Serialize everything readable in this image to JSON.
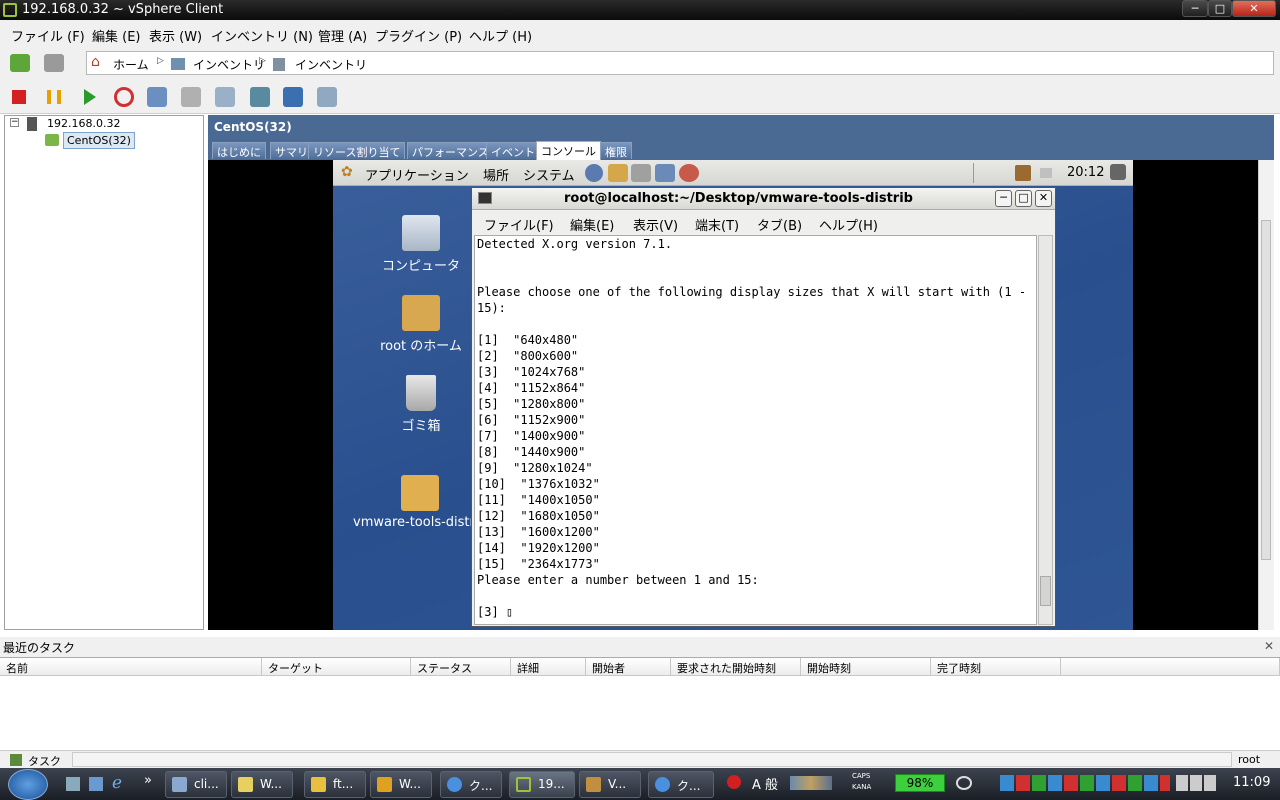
{
  "window": {
    "title": "192.168.0.32 ~ vSphere Client",
    "min": "─",
    "max": "□",
    "close": "✕"
  },
  "menu": [
    "ファイル (F)",
    "編集 (E)",
    "表示 (W)",
    "インベントリ (N)",
    "管理 (A)",
    "プラグイン (P)",
    "ヘルプ (H)"
  ],
  "nav": {
    "crumbs": [
      "ホーム",
      "インベントリ",
      "インベントリ"
    ]
  },
  "tree": {
    "host": "192.168.0.32",
    "vm": "CentOS(32)",
    "collapse": "−"
  },
  "vm": {
    "title": "CentOS(32)",
    "tabs": [
      "はじめに",
      "サマリ",
      "リソース割り当て",
      "パフォーマンス",
      "イベント",
      "コンソール",
      "権限"
    ],
    "active_tab": "コンソール"
  },
  "guest": {
    "panel": {
      "applications": "アプリケーション",
      "places": "場所",
      "system": "システム",
      "clock": "20:12"
    },
    "desktop_icons": [
      "コンピュータ",
      "root のホーム",
      "ゴミ箱",
      "vmware-tools-distr"
    ],
    "terminal": {
      "title": "root@localhost:~/Desktop/vmware-tools-distrib",
      "menu": [
        "ファイル(F)",
        "編集(E)",
        "表示(V)",
        "端末(T)",
        "タブ(B)",
        "ヘルプ(H)"
      ],
      "lines": [
        "Detected X.org version 7.1.",
        "",
        "",
        "Please choose one of the following display sizes that X will start with (1 -",
        "15):",
        "",
        "[1]  \"640x480\"",
        "[2]  \"800x600\"",
        "[3]  \"1024x768\"",
        "[4]  \"1152x864\"",
        "[5]  \"1280x800\"",
        "[6]  \"1152x900\"",
        "[7]  \"1400x900\"",
        "[8]  \"1440x900\"",
        "[9]  \"1280x1024\"",
        "[10]  \"1376x1032\"",
        "[11]  \"1400x1050\"",
        "[12]  \"1680x1050\"",
        "[13]  \"1600x1200\"",
        "[14]  \"1920x1200\"",
        "[15]  \"2364x1773\"",
        "Please enter a number between 1 and 15:",
        "",
        "[3] ▯"
      ]
    }
  },
  "tasks": {
    "header": "最近のタスク",
    "close": "✕",
    "columns": [
      "名前",
      "ターゲット",
      "ステータス",
      "詳細",
      "開始者",
      "要求された開始時刻",
      "開始時刻",
      "完了時刻"
    ]
  },
  "status": {
    "tasks_label": "タスク",
    "user": "root"
  },
  "taskbar": {
    "items": [
      "cli...",
      "W...",
      "ft...",
      "W...",
      "ク...",
      "19...",
      "V...",
      "ク..."
    ],
    "chevron": "»",
    "ime": "A 般",
    "caps": "CAPS",
    "kana": "KANA",
    "battery": "98%",
    "time": "11:09"
  },
  "colors": {
    "accent_green": "#9ec23a",
    "panel_blue": "#4a6a94",
    "desktop_blue": "#2a4f8e",
    "battery_green": "#3cd03c"
  }
}
